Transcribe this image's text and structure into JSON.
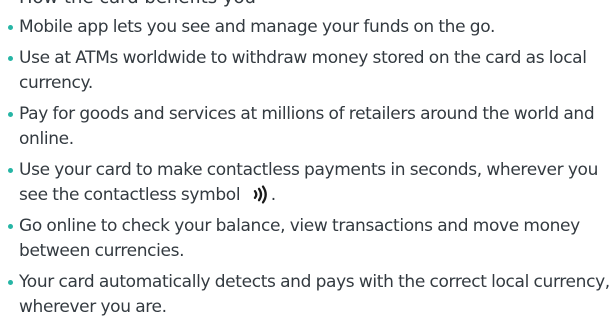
{
  "heading": "How the card benefits you",
  "colors": {
    "text": "#333a40",
    "bullet": "#26b5a5"
  },
  "benefits": [
    {
      "text": "Mobile app lets you see and manage your funds on the go."
    },
    {
      "text": "Use at ATMs worldwide to withdraw money stored on the card as local currency."
    },
    {
      "text": "Pay for goods and services at millions of retailers around the world and online."
    },
    {
      "text": "Use your card to make contactless payments in seconds, wherever you see the contactless symbol",
      "icon": "contactless-icon",
      "suffix": "."
    },
    {
      "text": "Go online to check your balance, view transactions and move money between currencies."
    },
    {
      "text": "Your card automatically detects and pays with the correct local currency, wherever you are."
    }
  ]
}
